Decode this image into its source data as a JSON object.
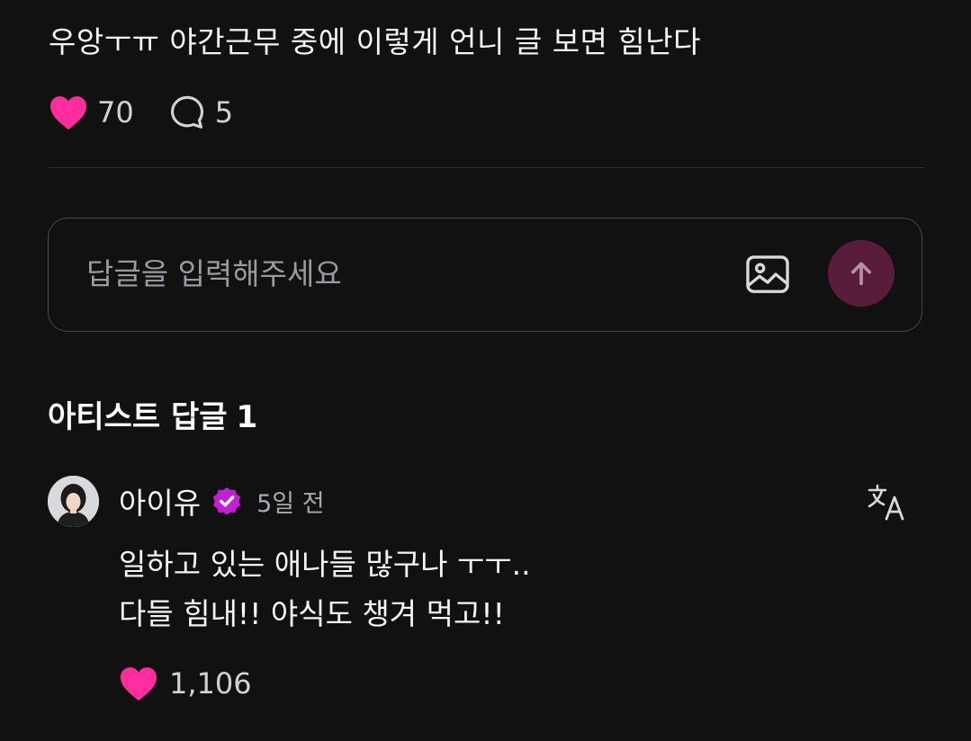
{
  "post": {
    "text": "우앙ㅜㅠ 야간근무 중에 이렇게 언니 글 보면 힘난다",
    "like_count": "70",
    "comment_count": "5"
  },
  "reply": {
    "placeholder": "답글을 입력해주세요"
  },
  "artist_section": {
    "title": "아티스트 답글",
    "count": "1"
  },
  "comment": {
    "author": "아이유",
    "time": "5일 전",
    "line1": "일하고 있는 애나들 많구나 ㅜㅜ..",
    "line2": "다들 힘내!! 야식도 챙겨 먹고!!",
    "like_count": "1,106"
  },
  "colors": {
    "background": "#111112",
    "heart": "#ff2d9e",
    "verified": "#c51fd4",
    "send_button": "#5a1c3b"
  },
  "icons": [
    "heart-icon",
    "comment-icon",
    "image-icon",
    "arrow-up-icon",
    "verified-badge-icon",
    "translate-icon"
  ]
}
